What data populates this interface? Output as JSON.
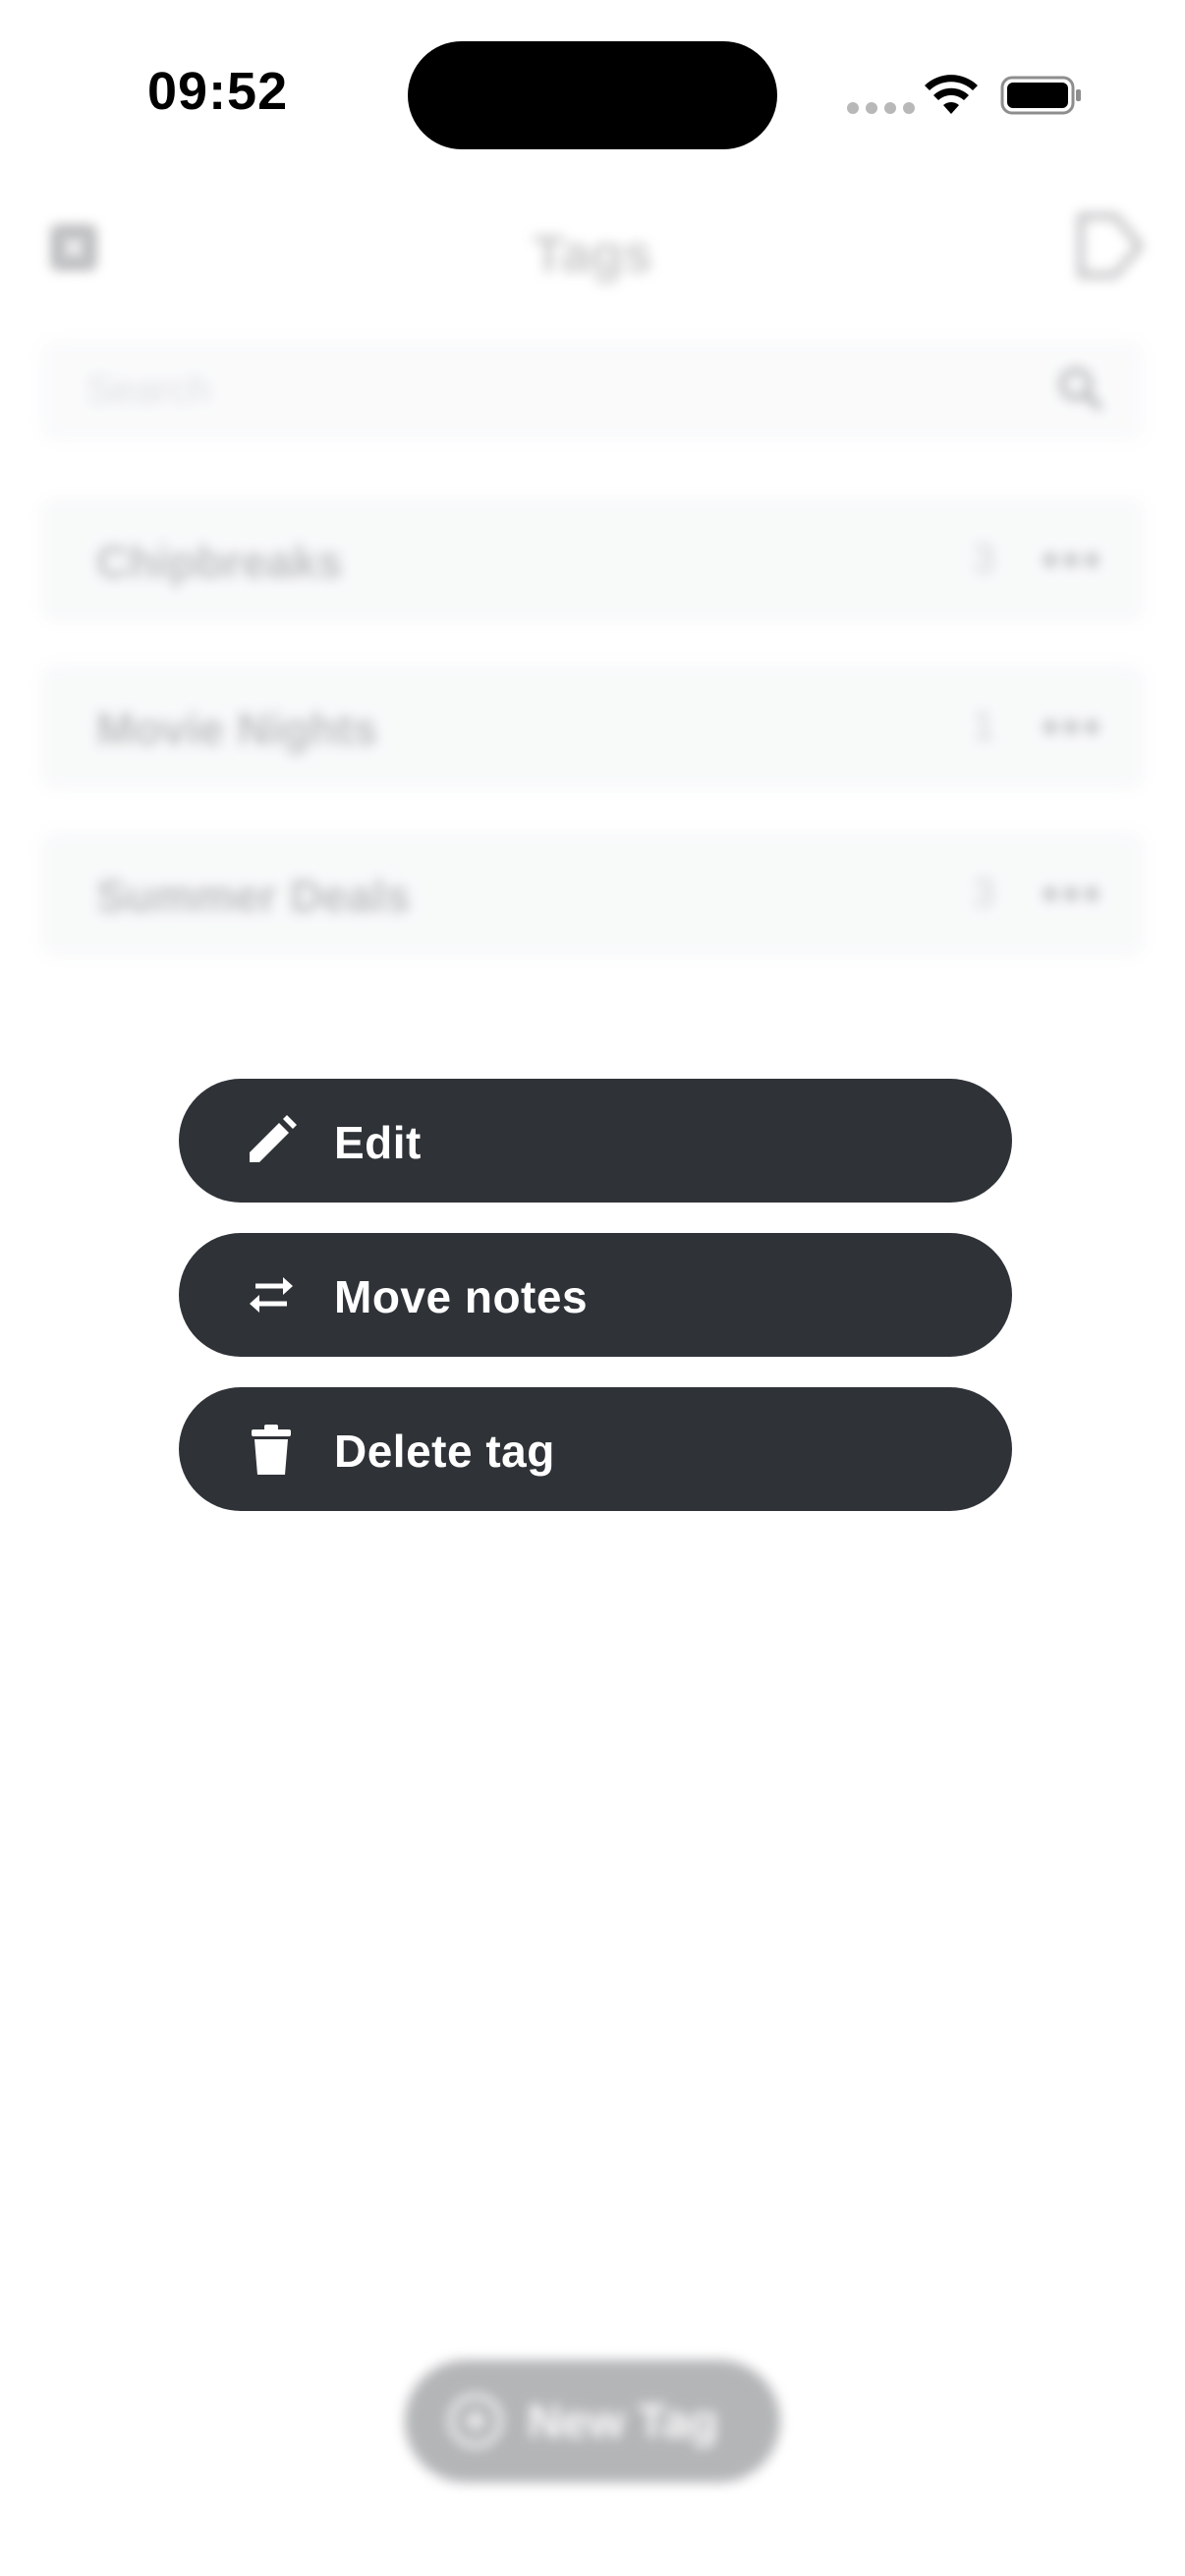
{
  "status_bar": {
    "time": "09:52"
  },
  "nav": {
    "title": "Tags"
  },
  "search": {
    "placeholder": "Search"
  },
  "tags": [
    {
      "name": "Chipbreaks",
      "count": "3"
    },
    {
      "name": "Movie Nights",
      "count": "1"
    },
    {
      "name": "Summer Deals",
      "count": "3"
    }
  ],
  "new_tag": {
    "label": "New Tag"
  },
  "context_menu": {
    "items": [
      {
        "label": "Edit",
        "icon": "pencil-icon"
      },
      {
        "label": "Move notes",
        "icon": "swap-arrows-icon"
      },
      {
        "label": "Delete tag",
        "icon": "trash-icon"
      }
    ]
  },
  "colors": {
    "menu_background": "#2f3338",
    "menu_text": "#ffffff",
    "screen_background": "#ffffff"
  }
}
